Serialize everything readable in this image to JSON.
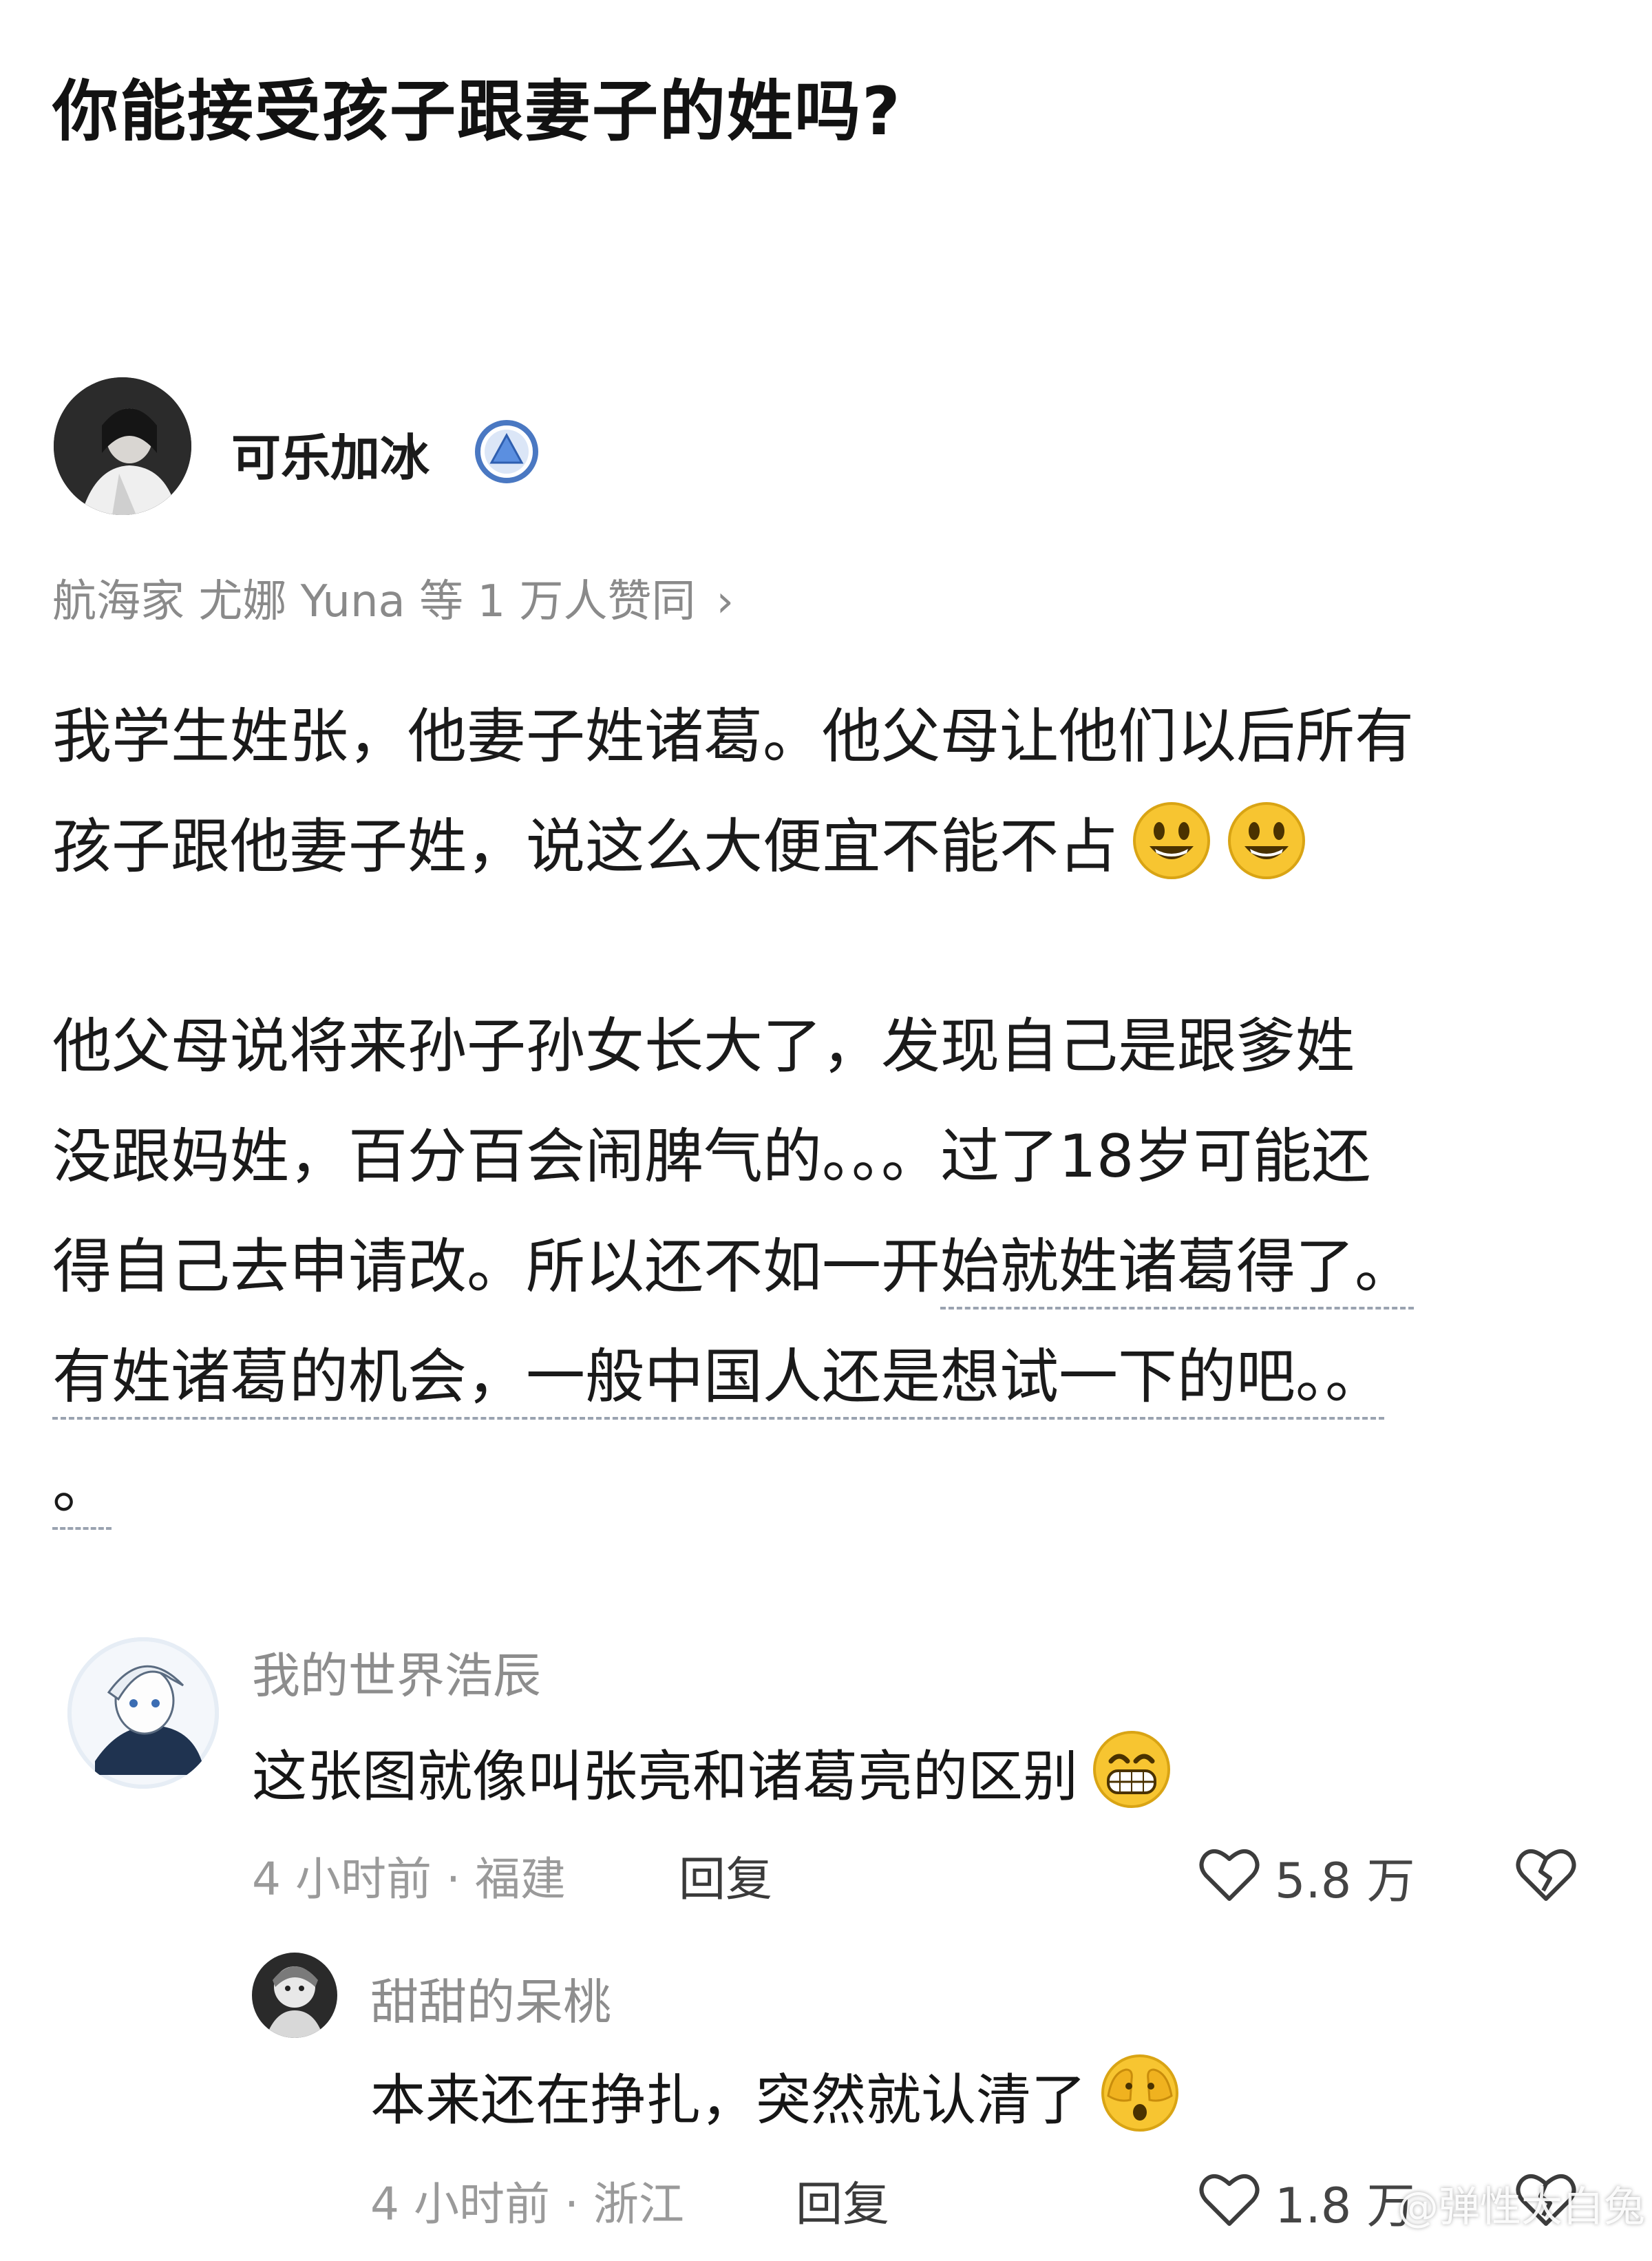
{
  "question": {
    "title": "你能接受孩子跟妻子的姓吗?"
  },
  "answer": {
    "author_name": "可乐加冰",
    "upvote_summary": "航海家 尤娜 Yuna 等 1 万人赞同",
    "upvote_chevron": "›",
    "paragraph1": {
      "line1": "我学生姓张，他妻子姓诸葛。他父母让他们以后所有",
      "line2": "孩子跟他妻子姓，说这么大便宜不能不占"
    },
    "paragraph2": {
      "line1": "他父母说将来孙子孙女长大了，发现自己是跟爹姓",
      "line2": "没跟妈姓，百分百会闹脾气的。。。过了18岁可能还",
      "line3_plain": "得自己去申请改。所以还不如一开",
      "line3_linked": "始就姓诸葛得了。",
      "line4": "有姓诸葛的机会，一般中国人还是想试一下的吧。。",
      "line5": "。"
    }
  },
  "comments": [
    {
      "user": "我的世界浩辰",
      "text": "这张图就像叫张亮和诸葛亮的区别",
      "time_location": "4 小时前 · 福建",
      "reply_label": "回复",
      "likes": "5.8 万",
      "emoji": "grin-emoji"
    },
    {
      "user": "甜甜的呆桃",
      "text": "本来还在挣扎，突然就认清了",
      "time_location": "4 小时前 · 浙江",
      "reply_label": "回复",
      "likes": "1.8 万",
      "emoji": "peeking-face-emoji"
    }
  ],
  "watermark": "@弹性大白兔",
  "colors": {
    "verify_badge": "#4a78c2",
    "emoji_yellow": "#f7c531",
    "muted_text": "#8a8a8a"
  }
}
